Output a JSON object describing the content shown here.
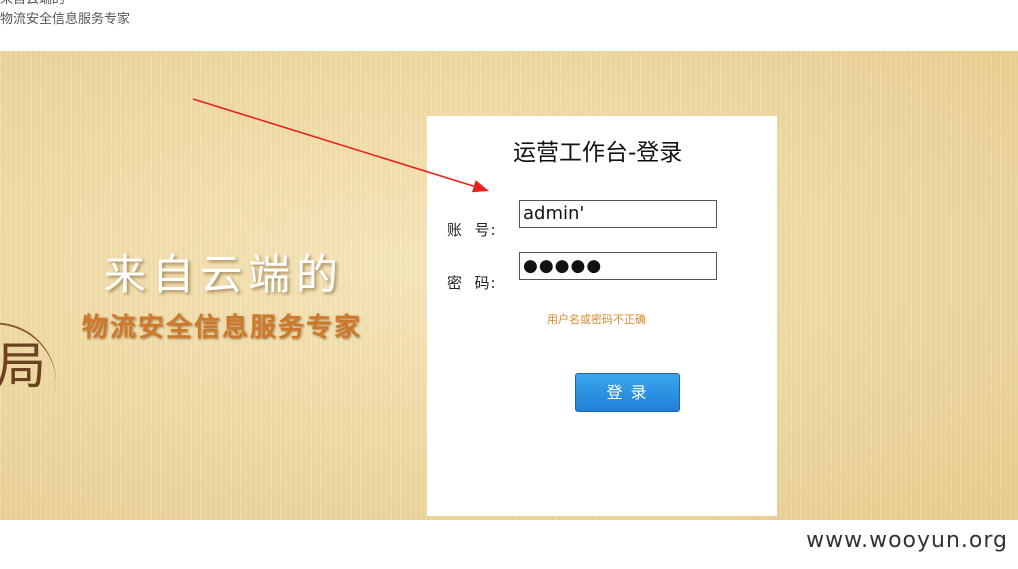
{
  "top_alt": {
    "line1": "来自云端的",
    "line2": "物流安全信息服务专家"
  },
  "banner": {
    "slogan_main": "来自云端的",
    "slogan_sub": "物流安全信息服务专家"
  },
  "login": {
    "title": "运营工作台-登录",
    "account_label": "账  号:",
    "password_label": "密  码:",
    "account_value": "admin'",
    "password_mask": "●●●●●",
    "error_message": "用户名或密码不正确",
    "submit_label": "登录"
  },
  "footer": {
    "watermark": "www.wooyun.org"
  },
  "colors": {
    "arrow": "#e8231f",
    "button": "#2a8fe0",
    "error": "#d98a2a",
    "slogan_sub": "#d0782a"
  }
}
